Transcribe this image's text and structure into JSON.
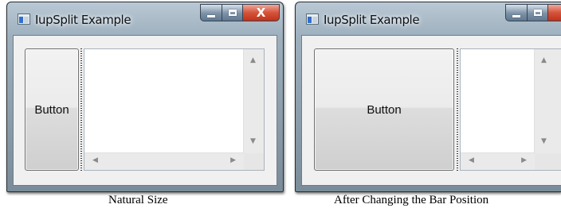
{
  "window_title": "IupSplit Example",
  "title_controls": {
    "close_glyph": "X"
  },
  "natural": {
    "button_label": "Button",
    "caption": "Natural Size"
  },
  "changed": {
    "button_label": "Button",
    "caption": "After Changing the Bar Position"
  },
  "colors": {
    "close": "#c2311a",
    "frame": "#9eb0be",
    "client": "#f0f0f0"
  }
}
